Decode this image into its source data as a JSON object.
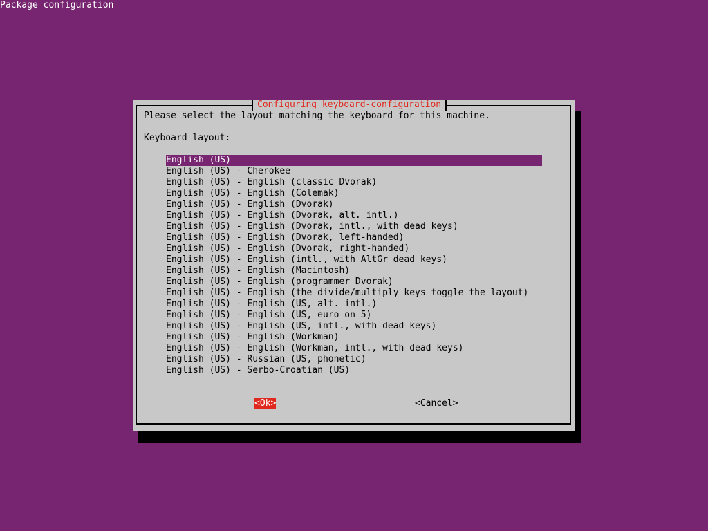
{
  "backtitle": "Package configuration",
  "dialog": {
    "title": "Configuring keyboard-configuration",
    "prompt": "Please select the layout matching the keyboard for this machine.",
    "list_label": "Keyboard layout:",
    "selected_index": 0,
    "items": [
      "English (US)",
      "English (US) - Cherokee",
      "English (US) - English (classic Dvorak)",
      "English (US) - English (Colemak)",
      "English (US) - English (Dvorak)",
      "English (US) - English (Dvorak, alt. intl.)",
      "English (US) - English (Dvorak, intl., with dead keys)",
      "English (US) - English (Dvorak, left-handed)",
      "English (US) - English (Dvorak, right-handed)",
      "English (US) - English (intl., with AltGr dead keys)",
      "English (US) - English (Macintosh)",
      "English (US) - English (programmer Dvorak)",
      "English (US) - English (the divide/multiply keys toggle the layout)",
      "English (US) - English (US, alt. intl.)",
      "English (US) - English (US, euro on 5)",
      "English (US) - English (US, intl., with dead keys)",
      "English (US) - English (Workman)",
      "English (US) - English (Workman, intl., with dead keys)",
      "English (US) - Russian (US, phonetic)",
      "English (US) - Serbo-Croatian (US)"
    ],
    "ok_label": "<Ok>",
    "cancel_label": "<Cancel>"
  },
  "colors": {
    "background": "#772570",
    "dialog": "#c8c8c8",
    "shadow": "#000000",
    "title_text": "#e0281e",
    "selection": "#772570",
    "ok_button": "#e0281e"
  }
}
